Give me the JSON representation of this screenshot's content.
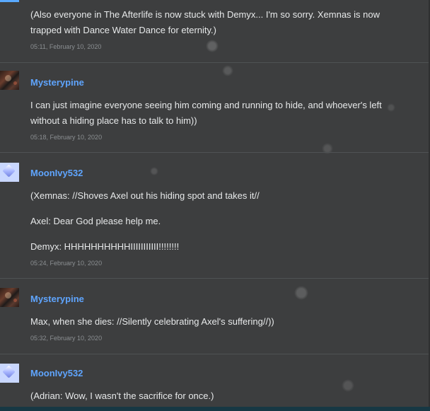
{
  "posts": [
    {
      "author": "",
      "avatar": "",
      "lines": [
        "(Also everyone in The Afterlife is now stuck with Demyx... I'm so sorry. Xemnas is now",
        "trapped with Dance Water Dance for eternity.)"
      ],
      "timestamp": "05:11, February 10, 2020"
    },
    {
      "author": "Mysterypine",
      "avatar": "mysterypine-avatar",
      "lines": [
        "I can just imagine everyone seeing him coming and running to hide, and whoever's left",
        "without a hiding place has to talk to him))"
      ],
      "timestamp": "05:18, February 10, 2020"
    },
    {
      "author": "MoonIvy532",
      "avatar": "moonivy532-avatar",
      "paragraphs": [
        "(Xemnas: //Shoves Axel out his hiding spot and takes it//",
        "Axel: Dear God please help me.",
        "Demyx: HHHHHHHHHHIIIIIIIIIII!!!!!!!!"
      ],
      "timestamp": "05:24, February 10, 2020"
    },
    {
      "author": "Mysterypine",
      "avatar": "mysterypine-avatar",
      "lines": [
        "Max, when she dies: //Silently celebrating Axel's suffering//))"
      ],
      "timestamp": "05:32, February 10, 2020"
    },
    {
      "author": "MoonIvy532",
      "avatar": "moonivy532-avatar",
      "lines": [
        "(Adrian: Wow, I wasn't the sacrifice for once.)"
      ]
    }
  ],
  "colors": {
    "background": "#3d3e3f",
    "author": "#5fa5ff",
    "text": "#e7e9ea",
    "timestamp": "#8b8f92",
    "divider": "#4f5254"
  }
}
